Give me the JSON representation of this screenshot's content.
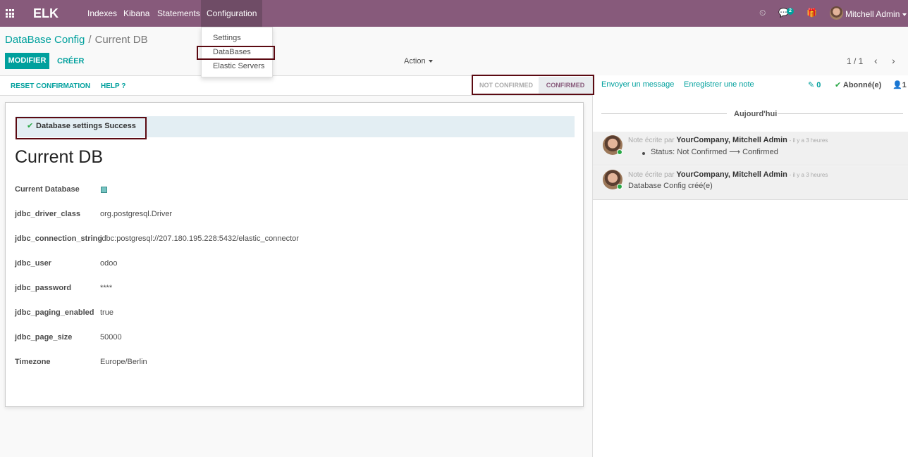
{
  "navbar": {
    "brand": "ELK",
    "menu": [
      "Indexes",
      "Kibana",
      "Statements",
      "Configuration"
    ],
    "chat_badge": "2",
    "user": "Mitchell Admin"
  },
  "dropdown": {
    "items": [
      "Settings",
      "DataBases",
      "Elastic Servers"
    ]
  },
  "breadcrumb": {
    "parent": "DataBase Config",
    "separator": "/",
    "current": "Current DB"
  },
  "buttons": {
    "edit": "MODIFIER",
    "create": "CRÉER",
    "action": "Action"
  },
  "pager": {
    "value": "1 / 1"
  },
  "statusbar": {
    "reset": "RESET CONFIRMATION",
    "help": "HELP ?",
    "stages": [
      "NOT CONFIRMED",
      "CONFIRMED"
    ],
    "active_stage": "CONFIRMED"
  },
  "form": {
    "alert": "Database settings Success",
    "title": "Current DB",
    "fields": [
      {
        "label": "Current Database",
        "value": ""
      },
      {
        "label": "jdbc_driver_class",
        "value": "org.postgresql.Driver"
      },
      {
        "label": "jdbc_connection_string",
        "value": "jdbc:postgresql://207.180.195.228:5432/elastic_connector"
      },
      {
        "label": "jdbc_user",
        "value": "odoo"
      },
      {
        "label": "jdbc_password",
        "value": "****"
      },
      {
        "label": "jdbc_paging_enabled",
        "value": "true"
      },
      {
        "label": "jdbc_page_size",
        "value": "50000"
      },
      {
        "label": "Timezone",
        "value": "Europe/Berlin"
      }
    ]
  },
  "chatter": {
    "send_message": "Envoyer un message",
    "log_note": "Enregistrer une note",
    "attachments": "0",
    "followed": "Abonné(e)",
    "followers": "1",
    "today": "Aujourd'hui",
    "messages": [
      {
        "prefix": "Note écrite par",
        "author": "YourCompany, Mitchell Admin",
        "time": "- il y a 3 heures",
        "body": "Status: Not Confirmed ⟶ Confirmed"
      },
      {
        "prefix": "Note écrite par",
        "author": "YourCompany, Mitchell Admin",
        "time": "- il y a 3 heures",
        "body": "Database Config créé(e)"
      }
    ]
  },
  "colors": {
    "brand": "#875a7b",
    "accent": "#00a09d",
    "highlight_box": "#5b0a12"
  }
}
